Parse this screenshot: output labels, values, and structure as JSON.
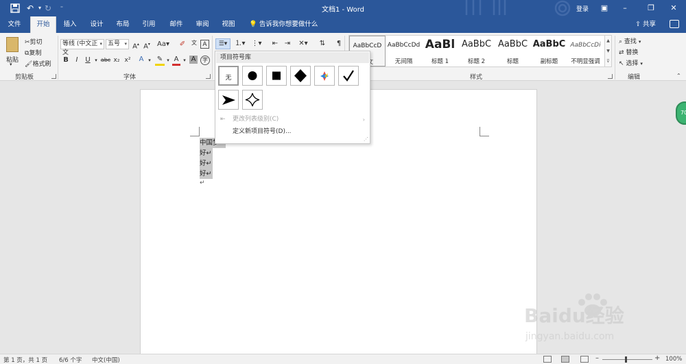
{
  "window": {
    "title": "文档1 - Word",
    "user": "登录"
  },
  "tabs": [
    "文件",
    "开始",
    "插入",
    "设计",
    "布局",
    "引用",
    "邮件",
    "审阅",
    "视图"
  ],
  "tellme": "告诉我你想要做什么",
  "share": "共享",
  "clipboard": {
    "paste": "粘贴",
    "cut": "剪切",
    "copy": "复制",
    "format_painter": "格式刷",
    "group_label": "剪贴板"
  },
  "font": {
    "font_name": "等线 (中文正文",
    "font_size": "五号",
    "group_label": "字体"
  },
  "styles": {
    "items": [
      {
        "sample": "AaBbCcD",
        "name": "正文",
        "weight": "normal",
        "size": "9px"
      },
      {
        "sample": "AaBbCcDd",
        "name": "无间隔",
        "weight": "normal",
        "size": "9px"
      },
      {
        "sample": "AaBl",
        "name": "标题 1",
        "weight": "bold",
        "size": "17px"
      },
      {
        "sample": "AaBbC",
        "name": "标题 2",
        "weight": "normal",
        "size": "14px"
      },
      {
        "sample": "AaBbC",
        "name": "标题",
        "weight": "normal",
        "size": "14px"
      },
      {
        "sample": "AaBbC",
        "name": "副标题",
        "weight": "bold",
        "size": "14px"
      },
      {
        "sample": "AaBbCcDi",
        "name": "不明显强调",
        "weight": "normal",
        "size": "9px"
      }
    ],
    "group_label": "样式"
  },
  "editing": {
    "find": "查找",
    "replace": "替换",
    "select": "选择",
    "group_label": "编辑"
  },
  "bullet_menu": {
    "header": "项目符号库",
    "none_label": "无",
    "change_level": "更改列表级别(C)",
    "define_new": "定义新项目符号(D)..."
  },
  "document": {
    "lines": [
      "中国梦",
      "好",
      "好",
      "好"
    ]
  },
  "status": {
    "page": "第 1 页，共 1 页",
    "words": "6/6 个字",
    "language": "中文(中国)",
    "zoom": "100%"
  },
  "badge": "70",
  "watermark": {
    "brand": "Baidu经验",
    "url": "jingyan.baidu.com"
  }
}
